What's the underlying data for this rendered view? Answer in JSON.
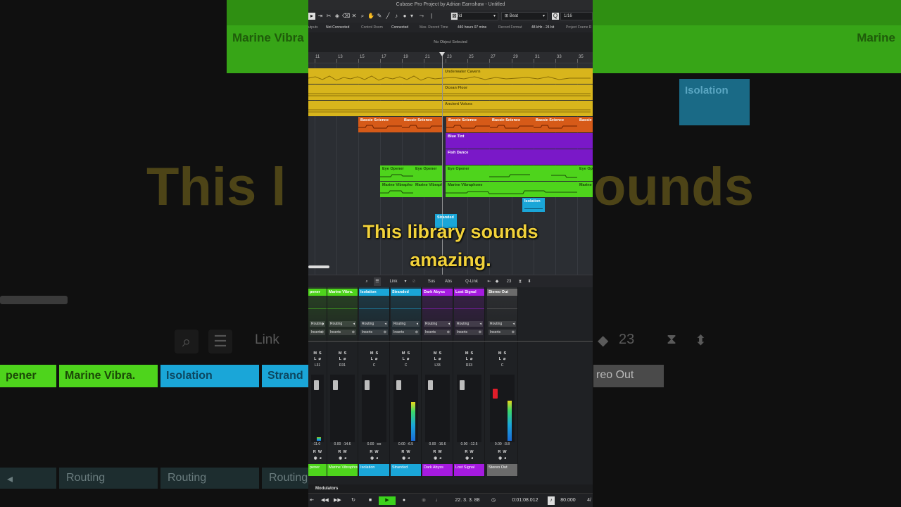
{
  "background": {
    "top_left_label": "Marine Vibra",
    "top_right_label": "Marine",
    "iso_label": "Isolation",
    "big_left": "This l",
    "big_right": "ounds",
    "link": "Link",
    "counter": "23",
    "channels": [
      "pener",
      "Marine Vibra.",
      "Isolation",
      "Strand"
    ],
    "stereo": "reo Out",
    "routing": "Routing"
  },
  "app": {
    "title": "Cubase Pro Project by Adrian Earnshaw - Untitled",
    "toolbar": {
      "snap_type": "Grid",
      "quantize_mode": "Beat",
      "quantize_value": "1/16"
    },
    "status": {
      "outputs_label": "utputs",
      "outputs_value": "Not Connected",
      "control_room_label": "Control Room",
      "control_room_value": "Connected",
      "max_record_label": "Max. Record Time",
      "max_record_value": "440 hours 07 mins",
      "record_format_label": "Record Format",
      "record_format_value": "48 kHz - 24 bit",
      "project_frame_label": "Project Frame R"
    },
    "info_line": "No Object Selected",
    "ruler": [
      "11",
      "13",
      "15",
      "17",
      "19",
      "21",
      "23",
      "25",
      "27",
      "29",
      "31",
      "33",
      "35"
    ],
    "clips": {
      "underwater": "Underwater Cavern",
      "ocean": "Ocean Floor",
      "ancient": "Ancient Voices",
      "bassic": "Bassic Science",
      "blue_tint": "Blue Tint",
      "fish_dance": "Fish Dance",
      "eye_opener": "Eye Opener",
      "eye_op": "Eye Op",
      "marine": "Marine Vibrapho",
      "marine_full": "Marine Vibraphone",
      "marine_short": "Marine",
      "isolation": "Isolation",
      "stranded": "Stranded"
    },
    "mixer_toolbar": {
      "link": "Link",
      "sus": "Sus",
      "abs": "Abs",
      "qlink": "Q-Link",
      "counter": "23"
    },
    "channels": [
      {
        "name": "pener",
        "bottom": "pener",
        "color": "#4ed41c",
        "pan": "L31",
        "vol": "-11.0",
        "peak": "",
        "num": "7",
        "meter": 0.05
      },
      {
        "name": "Marine Vibra.",
        "bottom": "Marine Vibraphone",
        "color": "#4ed41c",
        "pan": "R31",
        "vol": "0.00",
        "peak": "-14.6",
        "num": "8",
        "meter": 0.0
      },
      {
        "name": "Isolation",
        "bottom": "Isolation",
        "color": "#1aa6d8",
        "pan": "C",
        "vol": "0.00",
        "peak": "-oo",
        "num": "9",
        "meter": 0.0
      },
      {
        "name": "Stranded",
        "bottom": "Stranded",
        "color": "#1aa6d8",
        "pan": "C",
        "vol": "0.00",
        "peak": "-6.5",
        "num": "10",
        "meter": 0.6
      },
      {
        "name": "Dark Abyss",
        "bottom": "Dark Abyss",
        "color": "#a51ae0",
        "pan": "L33",
        "vol": "0.00",
        "peak": "-16.6",
        "num": "11",
        "meter": 0.0
      },
      {
        "name": "Lost Signal",
        "bottom": "Lost Signal",
        "color": "#a51ae0",
        "pan": "R33",
        "vol": "0.00",
        "peak": "-12.5",
        "num": "12",
        "meter": 0.0
      },
      {
        "name": "Stereo Out",
        "bottom": "Stereo Out",
        "color": "#6b6b6b",
        "pan": "C",
        "vol": "0.00",
        "peak": "-3.8",
        "num": "1",
        "meter": 0.62
      }
    ],
    "routing_label": "Routing",
    "inserts_label": "Inserts",
    "modulators": "Modulators",
    "transport": {
      "position": "22. 3. 3. 88",
      "time": "0:01:08.012",
      "tempo": "80.000",
      "sig": "4/"
    }
  },
  "subtitle": {
    "line1": "This library sounds",
    "line2": "amazing."
  }
}
